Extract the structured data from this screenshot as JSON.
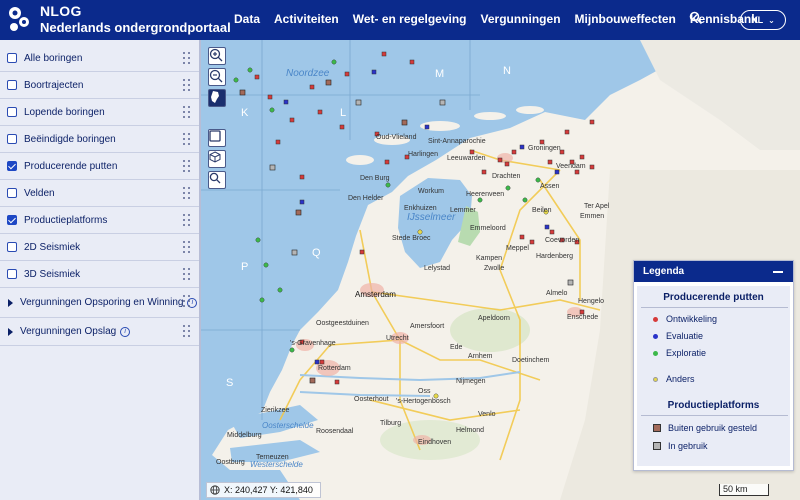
{
  "header": {
    "brand_title": "NLOG",
    "brand_subtitle": "Nederlands ondergrondportaal",
    "nav": [
      "Data",
      "Activiteiten",
      "Wet- en regelgeving",
      "Vergunningen",
      "Mijnbouweffecten",
      "Kennisbank"
    ],
    "language": "NL"
  },
  "sidebar": {
    "layers": [
      {
        "label": "Alle boringen",
        "checked": false,
        "type": "checkbox"
      },
      {
        "label": "Boortrajecten",
        "checked": false,
        "type": "checkbox"
      },
      {
        "label": "Lopende boringen",
        "checked": false,
        "type": "checkbox"
      },
      {
        "label": "Beëindigde boringen",
        "checked": false,
        "type": "checkbox"
      },
      {
        "label": "Producerende putten",
        "checked": true,
        "type": "checkbox"
      },
      {
        "label": "Velden",
        "checked": false,
        "type": "checkbox"
      },
      {
        "label": "Productieplatforms",
        "checked": true,
        "type": "checkbox"
      },
      {
        "label": "2D Seismiek",
        "checked": false,
        "type": "checkbox"
      },
      {
        "label": "3D Seismiek",
        "checked": false,
        "type": "checkbox"
      },
      {
        "label": "Vergunningen Opsporing en Winning",
        "type": "group"
      },
      {
        "label": "Vergunningen Opslag",
        "type": "group"
      }
    ]
  },
  "map": {
    "sea_labels": [
      "Noordzee",
      "IJsselmeer",
      "Oosterschelde",
      "Westerschelde"
    ],
    "block_labels": [
      "M",
      "N",
      "K",
      "L",
      "P",
      "Q",
      "S"
    ],
    "places": [
      "Sint-Annaparochie",
      "Leeuwarden",
      "Groningen",
      "Drachten",
      "Heerenveen",
      "Assen",
      "Emmen",
      "Ter Apel",
      "Beilen",
      "Coevorden",
      "Hardenberg",
      "Den Helder",
      "Workum",
      "Stede Broec",
      "Lelystad",
      "Zwolle",
      "Almelo",
      "Enschede",
      "Amsterdam",
      "Apeldoorn",
      "Amersfoort",
      "Utrecht",
      "Ede",
      "Arnhem",
      "Doetinchem",
      "Nijmegen",
      "Rotterdam",
      "Oostgeestduinen",
      "'s-Gravenhage",
      "Oosterhout",
      "Oss",
      "'s-Hertogenbosch",
      "Tilburg",
      "Eindhoven",
      "Venlo",
      "Roosendaal",
      "Middelburg",
      "Oostburg",
      "Terneuzen",
      "Zierikzee",
      "Oud-Vlieland",
      "Hengelo",
      "Den Burg",
      "Enkhuizen",
      "Veendam",
      "Emmeloord",
      "Lemmer",
      "Harlingen",
      "Meppel",
      "Kampen",
      "Helmond"
    ],
    "coordinates": "X: 240,427  Y: 421,840",
    "scale": "50 km"
  },
  "legend": {
    "title": "Legenda",
    "section1": "Producerende putten",
    "items1": [
      {
        "label": "Ontwikkeling",
        "color": "#d63a3a"
      },
      {
        "label": "Evaluatie",
        "color": "#2a33c9"
      },
      {
        "label": "Exploratie",
        "color": "#3cb84a"
      },
      {
        "label": "Anders",
        "color": "#e6d84a"
      }
    ],
    "section2": "Productieplatforms",
    "items2": [
      {
        "label": "Buiten gebruik gesteld",
        "color": "#a36a5a"
      },
      {
        "label": "In gebruik",
        "color": "#b5b5b5"
      }
    ]
  },
  "colors": {
    "header": "#0b2a8c",
    "sea": "#9fc7e8",
    "land": "#f4f1ea"
  }
}
